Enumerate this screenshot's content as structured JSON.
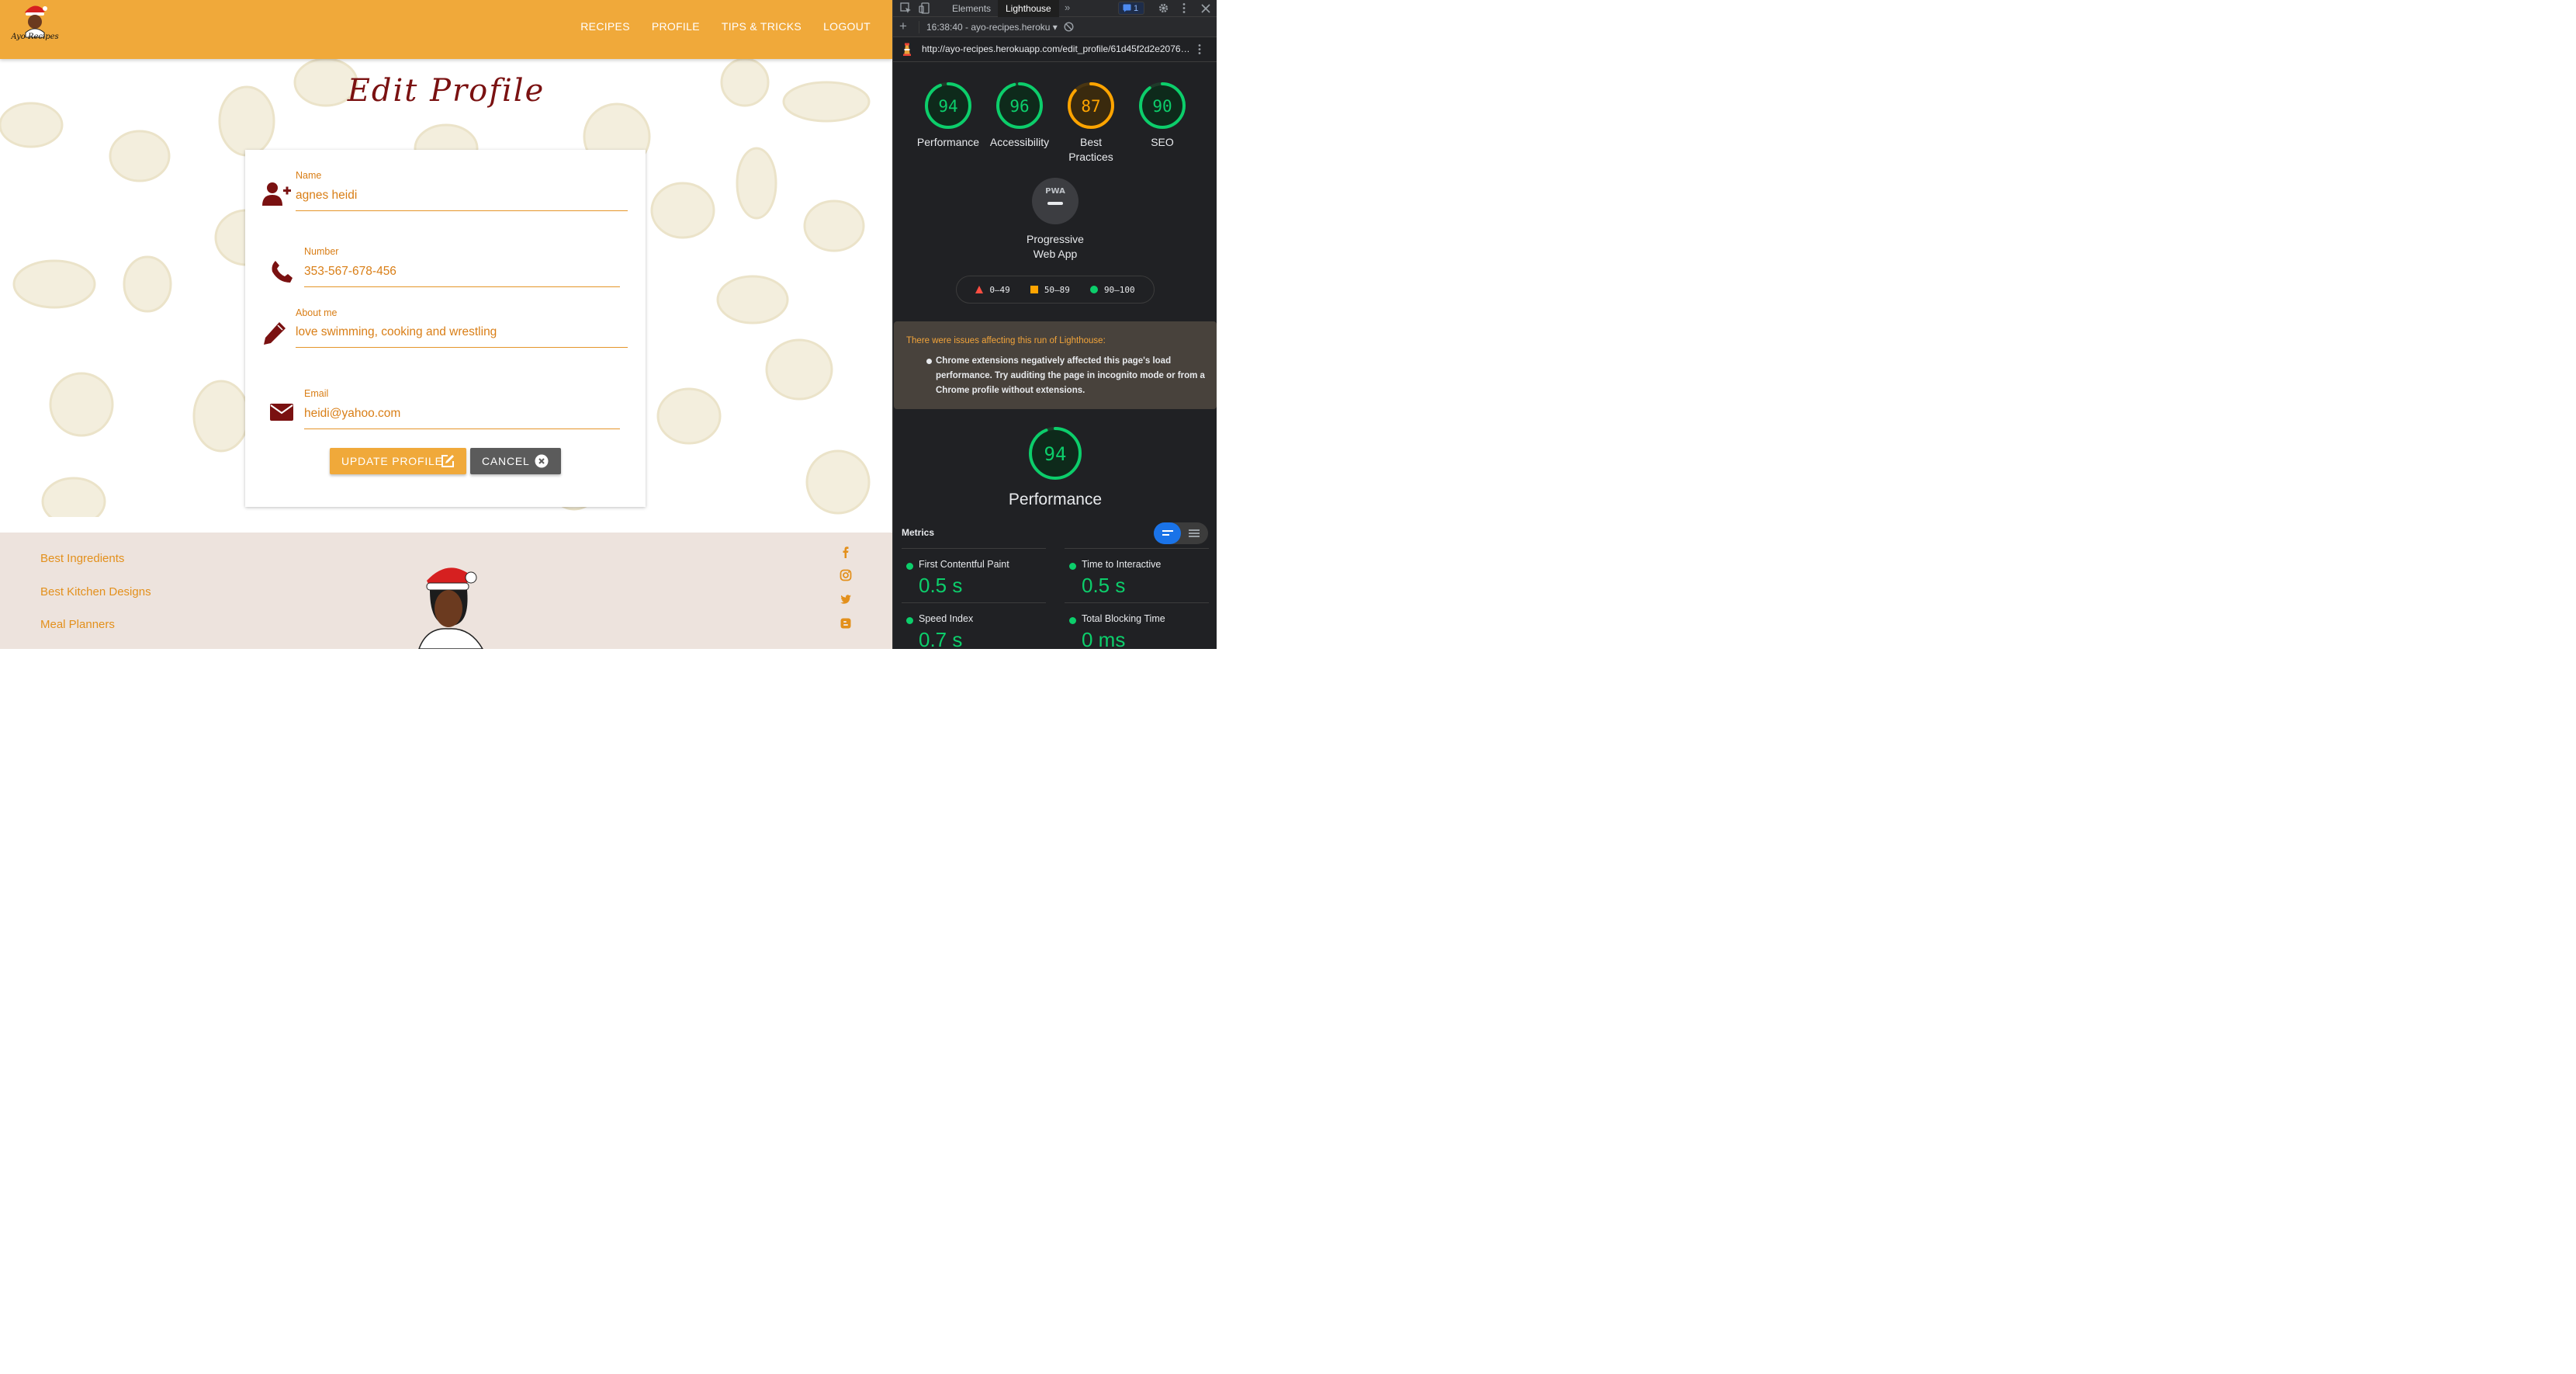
{
  "site": {
    "nav": [
      "RECIPES",
      "PROFILE",
      "TIPS & TRICKS",
      "LOGOUT"
    ],
    "title": "Edit Profile",
    "logo_text": "Ayo Recipes",
    "form": {
      "name_label": "Name",
      "name_value": "agnes heidi",
      "number_label": "Number",
      "number_value": "353-567-678-456",
      "about_label": "About me",
      "about_value": "love swimming, cooking and wrestling",
      "email_label": "Email",
      "email_value": "heidi@yahoo.com",
      "update_label": "UPDATE PROFILE",
      "cancel_label": "CANCEL"
    },
    "footer_links": [
      "Best Ingredients",
      "Best Kitchen Designs",
      "Meal Planners"
    ],
    "social_icons": [
      "facebook-icon",
      "instagram-icon",
      "twitter-icon",
      "blogger-icon"
    ],
    "colors": {
      "header": "#f0a93a",
      "accent": "#d97e16",
      "title": "#7a1111",
      "footer_bg": "#ede3dd"
    }
  },
  "devtools": {
    "tabs": [
      "Elements",
      "Lighthouse"
    ],
    "active_tab": "Lighthouse",
    "issues_badge": "1",
    "report_select": "16:38:40 - ayo-recipes.heroku",
    "url": "http://ayo-recipes.herokuapp.com/edit_profile/61d45f2d2e2076…",
    "scores": [
      {
        "label": "Performance",
        "value": 94,
        "color": "#0cce6b"
      },
      {
        "label": "Accessibility",
        "value": 96,
        "color": "#0cce6b"
      },
      {
        "label": "Best Practices",
        "value": 87,
        "color": "#ffa400"
      },
      {
        "label": "SEO",
        "value": 90,
        "color": "#0cce6b"
      }
    ],
    "score_labels": {
      "perf": "Performance",
      "a11y": "Accessibility",
      "bp1": "Best",
      "bp2": "Practices",
      "seo": "SEO"
    },
    "pwa": {
      "badge": "PWA",
      "label1": "Progressive",
      "label2": "Web App"
    },
    "legend": {
      "fail": "0–49",
      "average": "50–89",
      "pass": "90–100"
    },
    "warning": {
      "title": "There were issues affecting this run of Lighthouse:",
      "line1": "Chrome extensions negatively affected this page's load",
      "line2": "performance. Try auditing the page in incognito mode or from a",
      "line3": "Chrome profile without extensions."
    },
    "performance": {
      "score": 94,
      "label": "Performance"
    },
    "metrics_title": "Metrics",
    "metrics": {
      "fcp": {
        "name": "First Contentful Paint",
        "value": "0.5 s"
      },
      "tti": {
        "name": "Time to Interactive",
        "value": "0.5 s"
      },
      "si": {
        "name": "Speed Index",
        "value": "0.7 s"
      },
      "tbt": {
        "name": "Total Blocking Time",
        "value": "0 ms"
      }
    }
  }
}
